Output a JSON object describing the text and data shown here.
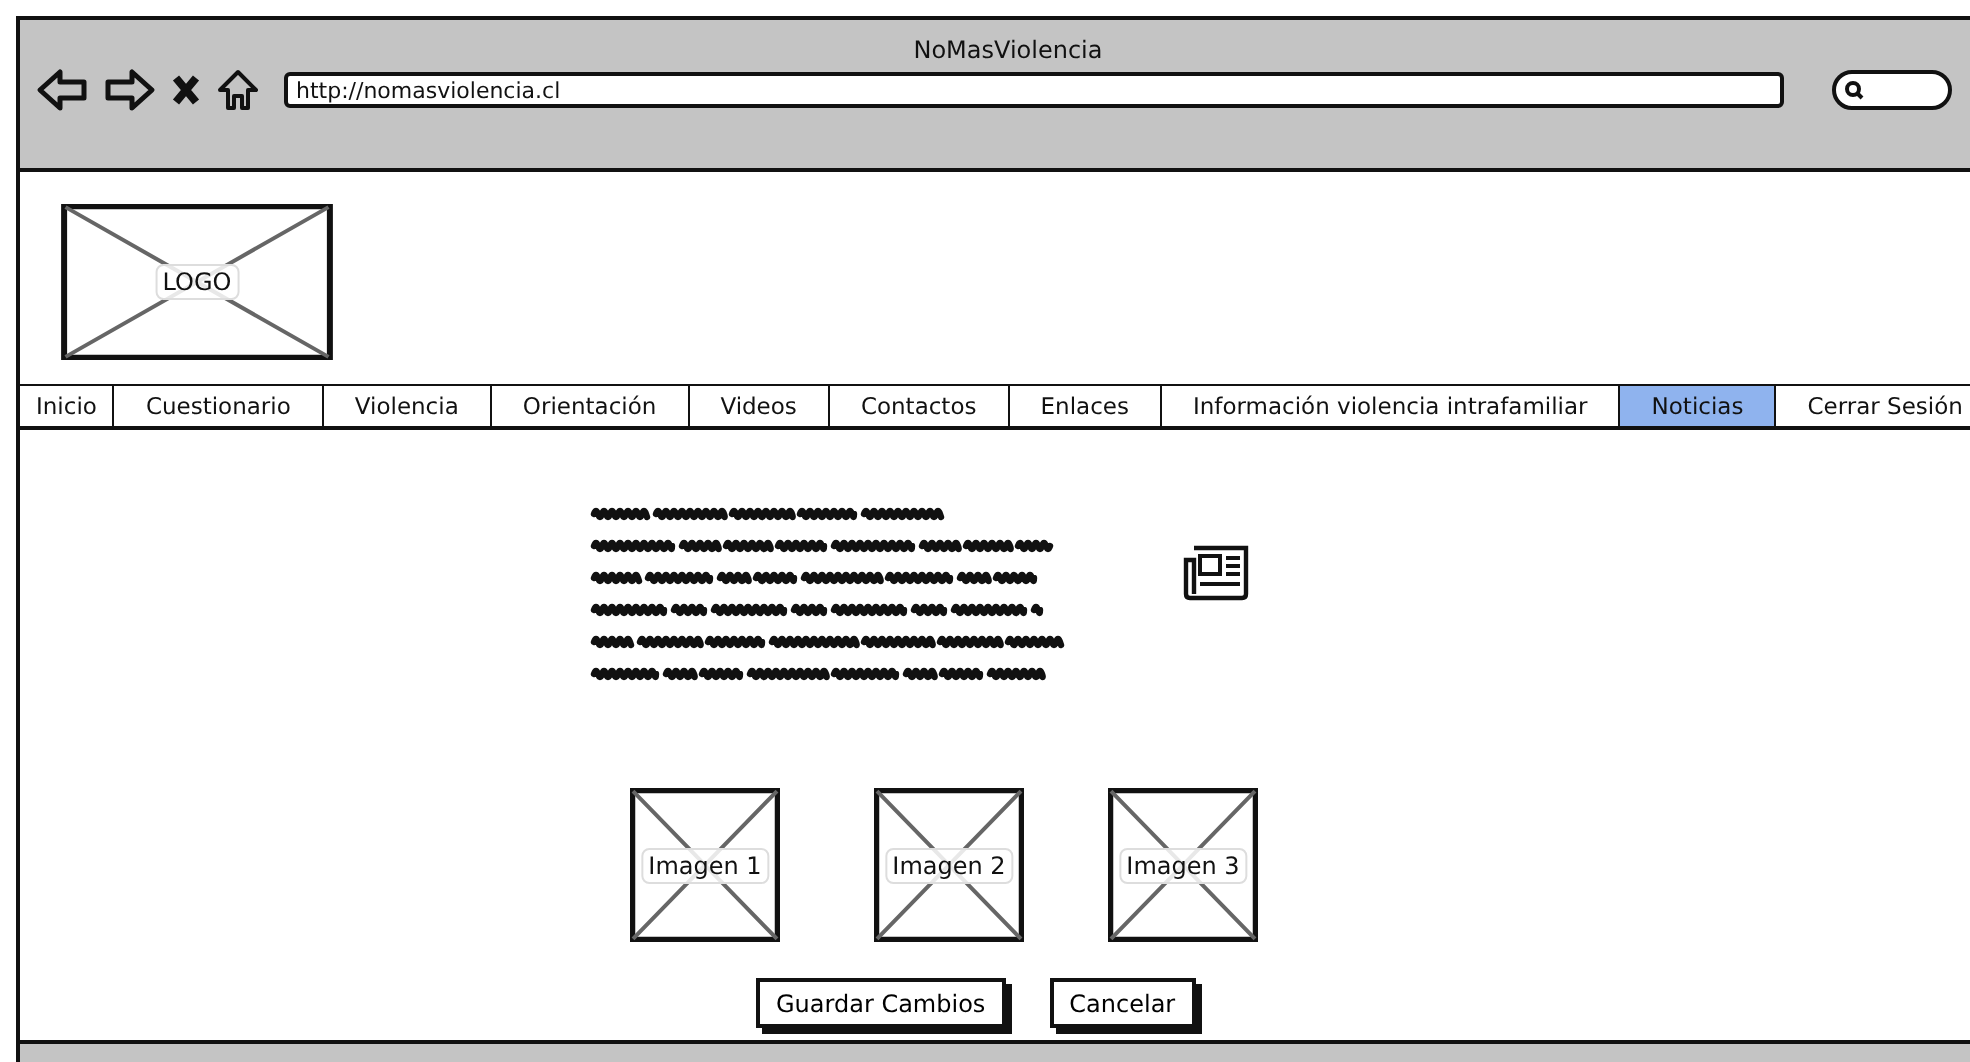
{
  "window": {
    "title": "NoMasViolencia"
  },
  "browser": {
    "address": "http://nomasviolencia.cl"
  },
  "logo": {
    "label": "LOGO"
  },
  "tabs": [
    {
      "label": "Inicio",
      "selected": false
    },
    {
      "label": "Cuestionario",
      "selected": false
    },
    {
      "label": "Violencia",
      "selected": false
    },
    {
      "label": "Orientación",
      "selected": false
    },
    {
      "label": "Videos",
      "selected": false
    },
    {
      "label": "Contactos",
      "selected": false
    },
    {
      "label": "Enlaces",
      "selected": false
    },
    {
      "label": "Información violencia intrafamiliar",
      "selected": false
    },
    {
      "label": "Noticias",
      "selected": true
    },
    {
      "label": "Cerrar Sesión",
      "selected": false
    }
  ],
  "images": [
    {
      "label": "Imagen 1"
    },
    {
      "label": "Imagen 2"
    },
    {
      "label": "Imagen 3"
    }
  ],
  "buttons": [
    "Guardar Cambios",
    "Cancelar"
  ]
}
